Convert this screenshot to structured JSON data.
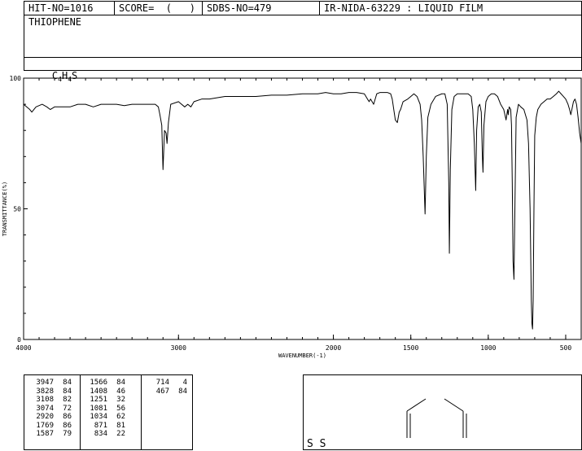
{
  "header": {
    "hit_no": "HIT-NO=1016",
    "score": "SCORE=  (   )",
    "sdbs_no": "SDBS-NO=479",
    "ir_id": "IR-NIDA-63229 : LIQUID FILM"
  },
  "compound": {
    "name": "THIOPHENE",
    "formula_parts": [
      "C",
      "4",
      "H",
      "4",
      "S"
    ]
  },
  "structure": {
    "label": "S S"
  },
  "chart_data": {
    "type": "line",
    "xlabel": "WAVENUMBER(-1)",
    "ylabel": "TRANSMITTANCE(%)",
    "xlim": [
      4000,
      400
    ],
    "ylim": [
      0,
      100
    ],
    "x_ticks": [
      4000,
      3000,
      2000,
      1500,
      1000,
      500
    ],
    "y_ticks": [
      0,
      50,
      100
    ],
    "grid": false,
    "series": [
      {
        "points": [
          [
            4000,
            90
          ],
          [
            3960,
            88
          ],
          [
            3947,
            87
          ],
          [
            3920,
            89
          ],
          [
            3880,
            90
          ],
          [
            3850,
            89
          ],
          [
            3828,
            88
          ],
          [
            3800,
            89
          ],
          [
            3750,
            89
          ],
          [
            3700,
            89
          ],
          [
            3650,
            90
          ],
          [
            3600,
            90
          ],
          [
            3550,
            89
          ],
          [
            3500,
            90
          ],
          [
            3450,
            90
          ],
          [
            3400,
            90
          ],
          [
            3350,
            89.5
          ],
          [
            3300,
            90
          ],
          [
            3250,
            90
          ],
          [
            3200,
            90
          ],
          [
            3150,
            90
          ],
          [
            3130,
            89
          ],
          [
            3120,
            86
          ],
          [
            3108,
            82
          ],
          [
            3100,
            65
          ],
          [
            3090,
            80
          ],
          [
            3080,
            79
          ],
          [
            3074,
            75
          ],
          [
            3065,
            83
          ],
          [
            3050,
            90
          ],
          [
            3000,
            91
          ],
          [
            2960,
            89
          ],
          [
            2940,
            90
          ],
          [
            2920,
            89
          ],
          [
            2900,
            91
          ],
          [
            2850,
            92
          ],
          [
            2800,
            92
          ],
          [
            2700,
            93
          ],
          [
            2600,
            93
          ],
          [
            2500,
            93
          ],
          [
            2400,
            93.5
          ],
          [
            2300,
            93.5
          ],
          [
            2200,
            94
          ],
          [
            2100,
            94
          ],
          [
            2050,
            94.5
          ],
          [
            2000,
            94
          ],
          [
            1950,
            94
          ],
          [
            1900,
            94.5
          ],
          [
            1850,
            94.5
          ],
          [
            1800,
            94
          ],
          [
            1780,
            92
          ],
          [
            1769,
            91
          ],
          [
            1760,
            92
          ],
          [
            1740,
            90
          ],
          [
            1720,
            94
          ],
          [
            1700,
            94.5
          ],
          [
            1680,
            94.5
          ],
          [
            1650,
            94.5
          ],
          [
            1630,
            94
          ],
          [
            1620,
            92
          ],
          [
            1610,
            88
          ],
          [
            1600,
            84
          ],
          [
            1587,
            83
          ],
          [
            1575,
            87
          ],
          [
            1566,
            88
          ],
          [
            1550,
            91
          ],
          [
            1520,
            92
          ],
          [
            1500,
            93
          ],
          [
            1480,
            94
          ],
          [
            1460,
            93
          ],
          [
            1440,
            90
          ],
          [
            1430,
            84
          ],
          [
            1420,
            70
          ],
          [
            1408,
            48
          ],
          [
            1400,
            70
          ],
          [
            1390,
            85
          ],
          [
            1370,
            90
          ],
          [
            1340,
            93
          ],
          [
            1300,
            94
          ],
          [
            1280,
            94
          ],
          [
            1265,
            90
          ],
          [
            1255,
            60
          ],
          [
            1251,
            33
          ],
          [
            1245,
            65
          ],
          [
            1235,
            88
          ],
          [
            1220,
            93
          ],
          [
            1200,
            94
          ],
          [
            1160,
            94
          ],
          [
            1130,
            94
          ],
          [
            1110,
            93
          ],
          [
            1100,
            88
          ],
          [
            1090,
            75
          ],
          [
            1081,
            57
          ],
          [
            1075,
            80
          ],
          [
            1065,
            89
          ],
          [
            1055,
            90
          ],
          [
            1045,
            87
          ],
          [
            1038,
            70
          ],
          [
            1034,
            64
          ],
          [
            1028,
            82
          ],
          [
            1015,
            91
          ],
          [
            1000,
            93
          ],
          [
            980,
            94
          ],
          [
            960,
            94
          ],
          [
            940,
            93
          ],
          [
            920,
            90
          ],
          [
            900,
            88
          ],
          [
            885,
            84
          ],
          [
            875,
            88
          ],
          [
            871,
            86
          ],
          [
            865,
            89
          ],
          [
            855,
            88
          ],
          [
            850,
            82
          ],
          [
            845,
            60
          ],
          [
            840,
            30
          ],
          [
            834,
            23
          ],
          [
            828,
            50
          ],
          [
            820,
            85
          ],
          [
            805,
            90
          ],
          [
            790,
            89
          ],
          [
            770,
            88
          ],
          [
            750,
            84
          ],
          [
            740,
            75
          ],
          [
            730,
            50
          ],
          [
            722,
            15
          ],
          [
            718,
            6
          ],
          [
            714,
            4
          ],
          [
            710,
            15
          ],
          [
            705,
            50
          ],
          [
            700,
            78
          ],
          [
            690,
            85
          ],
          [
            680,
            88
          ],
          [
            660,
            90
          ],
          [
            640,
            91
          ],
          [
            620,
            92
          ],
          [
            600,
            92
          ],
          [
            580,
            93
          ],
          [
            560,
            94
          ],
          [
            545,
            95
          ],
          [
            530,
            94
          ],
          [
            515,
            93
          ],
          [
            500,
            92
          ],
          [
            485,
            90
          ],
          [
            475,
            88
          ],
          [
            467,
            86
          ],
          [
            460,
            88
          ],
          [
            450,
            91
          ],
          [
            440,
            92
          ],
          [
            430,
            90
          ],
          [
            420,
            85
          ],
          [
            410,
            79
          ],
          [
            400,
            75
          ]
        ]
      }
    ]
  },
  "peak_table": {
    "columns": [
      [
        [
          "3947",
          "84"
        ],
        [
          "3828",
          "84"
        ],
        [
          "3108",
          "82"
        ],
        [
          "3074",
          "72"
        ],
        [
          "2920",
          "86"
        ],
        [
          "1769",
          "86"
        ],
        [
          "1587",
          "79"
        ]
      ],
      [
        [
          "1566",
          "84"
        ],
        [
          "1408",
          "46"
        ],
        [
          "1251",
          "32"
        ],
        [
          "1081",
          "56"
        ],
        [
          "1034",
          "62"
        ],
        [
          "871",
          "81"
        ],
        [
          "834",
          "22"
        ]
      ],
      [
        [
          "714",
          "4"
        ],
        [
          "467",
          "84"
        ]
      ]
    ]
  }
}
